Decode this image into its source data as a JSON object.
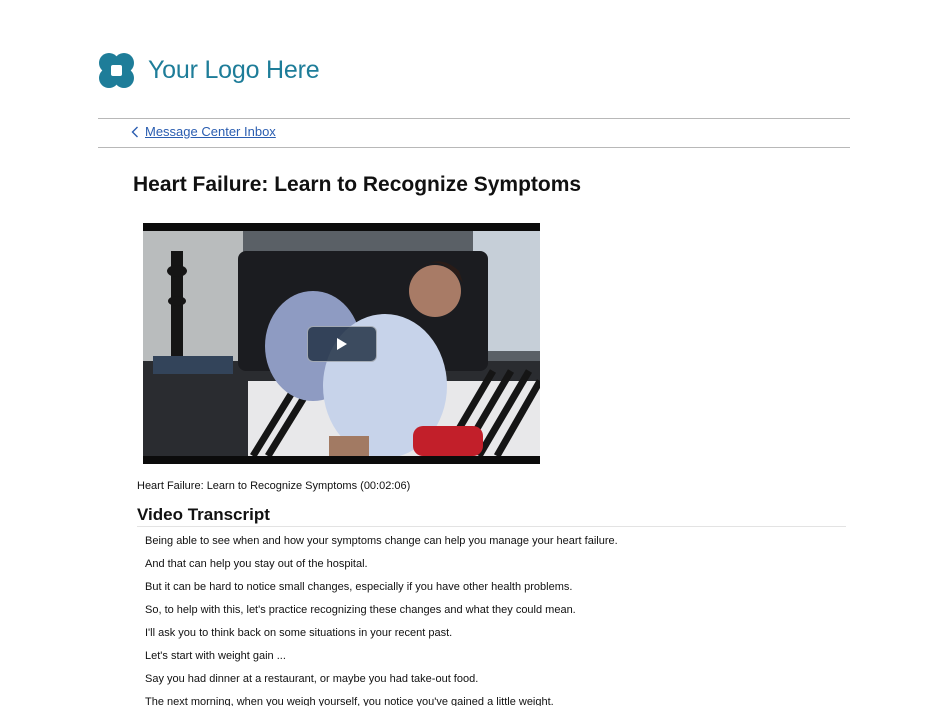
{
  "branding": {
    "logo_text": "Your Logo Here",
    "color": "#1e7d99",
    "icon": "logo-quatrefoil-icon"
  },
  "nav": {
    "back_icon": "chevron-left-icon",
    "back_label": "Message Center Inbox"
  },
  "content": {
    "title": "Heart Failure: Learn to Recognize Symptoms",
    "video": {
      "play_icon": "play-icon",
      "caption": "Heart Failure: Learn to Recognize Symptoms (00:02:06)"
    },
    "transcript": {
      "heading": "Video Transcript",
      "lines": [
        "Being able to see when and how your symptoms change can help you manage your heart failure.",
        "And that can help you stay out of the hospital.",
        "But it can be hard to notice small changes, especially if you have other health problems.",
        "So, to help with this, let's practice recognizing these changes and what they could mean.",
        "I'll ask you to think back on some situations in your recent past.",
        "Let's start with weight gain ...",
        "Say you had dinner at a restaurant, or maybe you had take-out food.",
        "The next morning, when you weigh yourself, you notice you've gained a little weight."
      ]
    }
  },
  "colors": {
    "link": "#2a5db0",
    "divider": "#b8b8b8"
  }
}
